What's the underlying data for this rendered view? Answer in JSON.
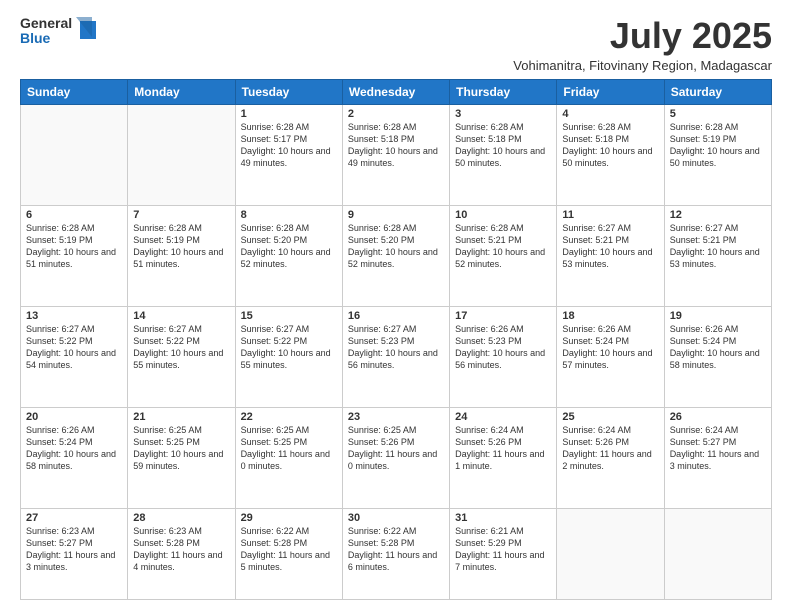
{
  "header": {
    "logo_general": "General",
    "logo_blue": "Blue",
    "month_title": "July 2025",
    "subtitle": "Vohimanitra, Fitovinany Region, Madagascar"
  },
  "days_of_week": [
    "Sunday",
    "Monday",
    "Tuesday",
    "Wednesday",
    "Thursday",
    "Friday",
    "Saturday"
  ],
  "weeks": [
    [
      {
        "day": "",
        "info": ""
      },
      {
        "day": "",
        "info": ""
      },
      {
        "day": "1",
        "info": "Sunrise: 6:28 AM\nSunset: 5:17 PM\nDaylight: 10 hours and 49 minutes."
      },
      {
        "day": "2",
        "info": "Sunrise: 6:28 AM\nSunset: 5:18 PM\nDaylight: 10 hours and 49 minutes."
      },
      {
        "day": "3",
        "info": "Sunrise: 6:28 AM\nSunset: 5:18 PM\nDaylight: 10 hours and 50 minutes."
      },
      {
        "day": "4",
        "info": "Sunrise: 6:28 AM\nSunset: 5:18 PM\nDaylight: 10 hours and 50 minutes."
      },
      {
        "day": "5",
        "info": "Sunrise: 6:28 AM\nSunset: 5:19 PM\nDaylight: 10 hours and 50 minutes."
      }
    ],
    [
      {
        "day": "6",
        "info": "Sunrise: 6:28 AM\nSunset: 5:19 PM\nDaylight: 10 hours and 51 minutes."
      },
      {
        "day": "7",
        "info": "Sunrise: 6:28 AM\nSunset: 5:19 PM\nDaylight: 10 hours and 51 minutes."
      },
      {
        "day": "8",
        "info": "Sunrise: 6:28 AM\nSunset: 5:20 PM\nDaylight: 10 hours and 52 minutes."
      },
      {
        "day": "9",
        "info": "Sunrise: 6:28 AM\nSunset: 5:20 PM\nDaylight: 10 hours and 52 minutes."
      },
      {
        "day": "10",
        "info": "Sunrise: 6:28 AM\nSunset: 5:21 PM\nDaylight: 10 hours and 52 minutes."
      },
      {
        "day": "11",
        "info": "Sunrise: 6:27 AM\nSunset: 5:21 PM\nDaylight: 10 hours and 53 minutes."
      },
      {
        "day": "12",
        "info": "Sunrise: 6:27 AM\nSunset: 5:21 PM\nDaylight: 10 hours and 53 minutes."
      }
    ],
    [
      {
        "day": "13",
        "info": "Sunrise: 6:27 AM\nSunset: 5:22 PM\nDaylight: 10 hours and 54 minutes."
      },
      {
        "day": "14",
        "info": "Sunrise: 6:27 AM\nSunset: 5:22 PM\nDaylight: 10 hours and 55 minutes."
      },
      {
        "day": "15",
        "info": "Sunrise: 6:27 AM\nSunset: 5:22 PM\nDaylight: 10 hours and 55 minutes."
      },
      {
        "day": "16",
        "info": "Sunrise: 6:27 AM\nSunset: 5:23 PM\nDaylight: 10 hours and 56 minutes."
      },
      {
        "day": "17",
        "info": "Sunrise: 6:26 AM\nSunset: 5:23 PM\nDaylight: 10 hours and 56 minutes."
      },
      {
        "day": "18",
        "info": "Sunrise: 6:26 AM\nSunset: 5:24 PM\nDaylight: 10 hours and 57 minutes."
      },
      {
        "day": "19",
        "info": "Sunrise: 6:26 AM\nSunset: 5:24 PM\nDaylight: 10 hours and 58 minutes."
      }
    ],
    [
      {
        "day": "20",
        "info": "Sunrise: 6:26 AM\nSunset: 5:24 PM\nDaylight: 10 hours and 58 minutes."
      },
      {
        "day": "21",
        "info": "Sunrise: 6:25 AM\nSunset: 5:25 PM\nDaylight: 10 hours and 59 minutes."
      },
      {
        "day": "22",
        "info": "Sunrise: 6:25 AM\nSunset: 5:25 PM\nDaylight: 11 hours and 0 minutes."
      },
      {
        "day": "23",
        "info": "Sunrise: 6:25 AM\nSunset: 5:26 PM\nDaylight: 11 hours and 0 minutes."
      },
      {
        "day": "24",
        "info": "Sunrise: 6:24 AM\nSunset: 5:26 PM\nDaylight: 11 hours and 1 minute."
      },
      {
        "day": "25",
        "info": "Sunrise: 6:24 AM\nSunset: 5:26 PM\nDaylight: 11 hours and 2 minutes."
      },
      {
        "day": "26",
        "info": "Sunrise: 6:24 AM\nSunset: 5:27 PM\nDaylight: 11 hours and 3 minutes."
      }
    ],
    [
      {
        "day": "27",
        "info": "Sunrise: 6:23 AM\nSunset: 5:27 PM\nDaylight: 11 hours and 3 minutes."
      },
      {
        "day": "28",
        "info": "Sunrise: 6:23 AM\nSunset: 5:28 PM\nDaylight: 11 hours and 4 minutes."
      },
      {
        "day": "29",
        "info": "Sunrise: 6:22 AM\nSunset: 5:28 PM\nDaylight: 11 hours and 5 minutes."
      },
      {
        "day": "30",
        "info": "Sunrise: 6:22 AM\nSunset: 5:28 PM\nDaylight: 11 hours and 6 minutes."
      },
      {
        "day": "31",
        "info": "Sunrise: 6:21 AM\nSunset: 5:29 PM\nDaylight: 11 hours and 7 minutes."
      },
      {
        "day": "",
        "info": ""
      },
      {
        "day": "",
        "info": ""
      }
    ]
  ]
}
